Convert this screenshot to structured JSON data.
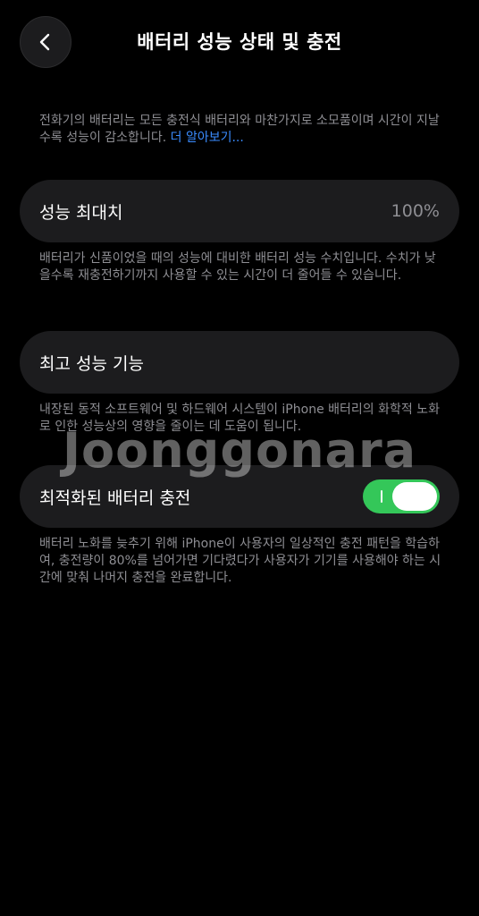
{
  "header": {
    "title": "배터리 성능 상태 및 충전",
    "back_icon": "chevron-left-icon"
  },
  "intro": {
    "text": "전화기의 배터리는 모든 충전식 배터리와 마찬가지로 소모품이며 시간이 지날수록 성능이 감소합니다. ",
    "link": "더 알아보기..."
  },
  "max_capacity": {
    "label": "성능 최대치",
    "value": "100%",
    "note": "배터리가 신품이었을 때의 성능에 대비한 배터리 성능 수치입니다. 수치가 낮을수록 재충전하기까지 사용할 수 있는 시간이 더 줄어들 수 있습니다."
  },
  "peak_performance": {
    "label": "최고 성능 기능",
    "note": "내장된 동적 소프트웨어 및 하드웨어 시스템이 iPhone 배터리의 화학적 노화로 인한 성능상의 영향을 줄이는 데 도움이 됩니다."
  },
  "optimized_charging": {
    "label": "최적화된 배터리 충전",
    "toggle_on": true,
    "note": "배터리 노화를 늦추기 위해 iPhone이 사용자의 일상적인 충전 패턴을 학습하여, 충전량이 80%를 넘어가면 기다렸다가 사용자가 기기를 사용해야 하는 시간에 맞춰 나머지 충전을 완료합니다."
  },
  "watermark": "Joonggonara",
  "colors": {
    "background": "#000000",
    "row_background": "#1c1c1e",
    "secondary_text": "#8e8e93",
    "link": "#3a8cff",
    "toggle_on": "#34c759"
  }
}
